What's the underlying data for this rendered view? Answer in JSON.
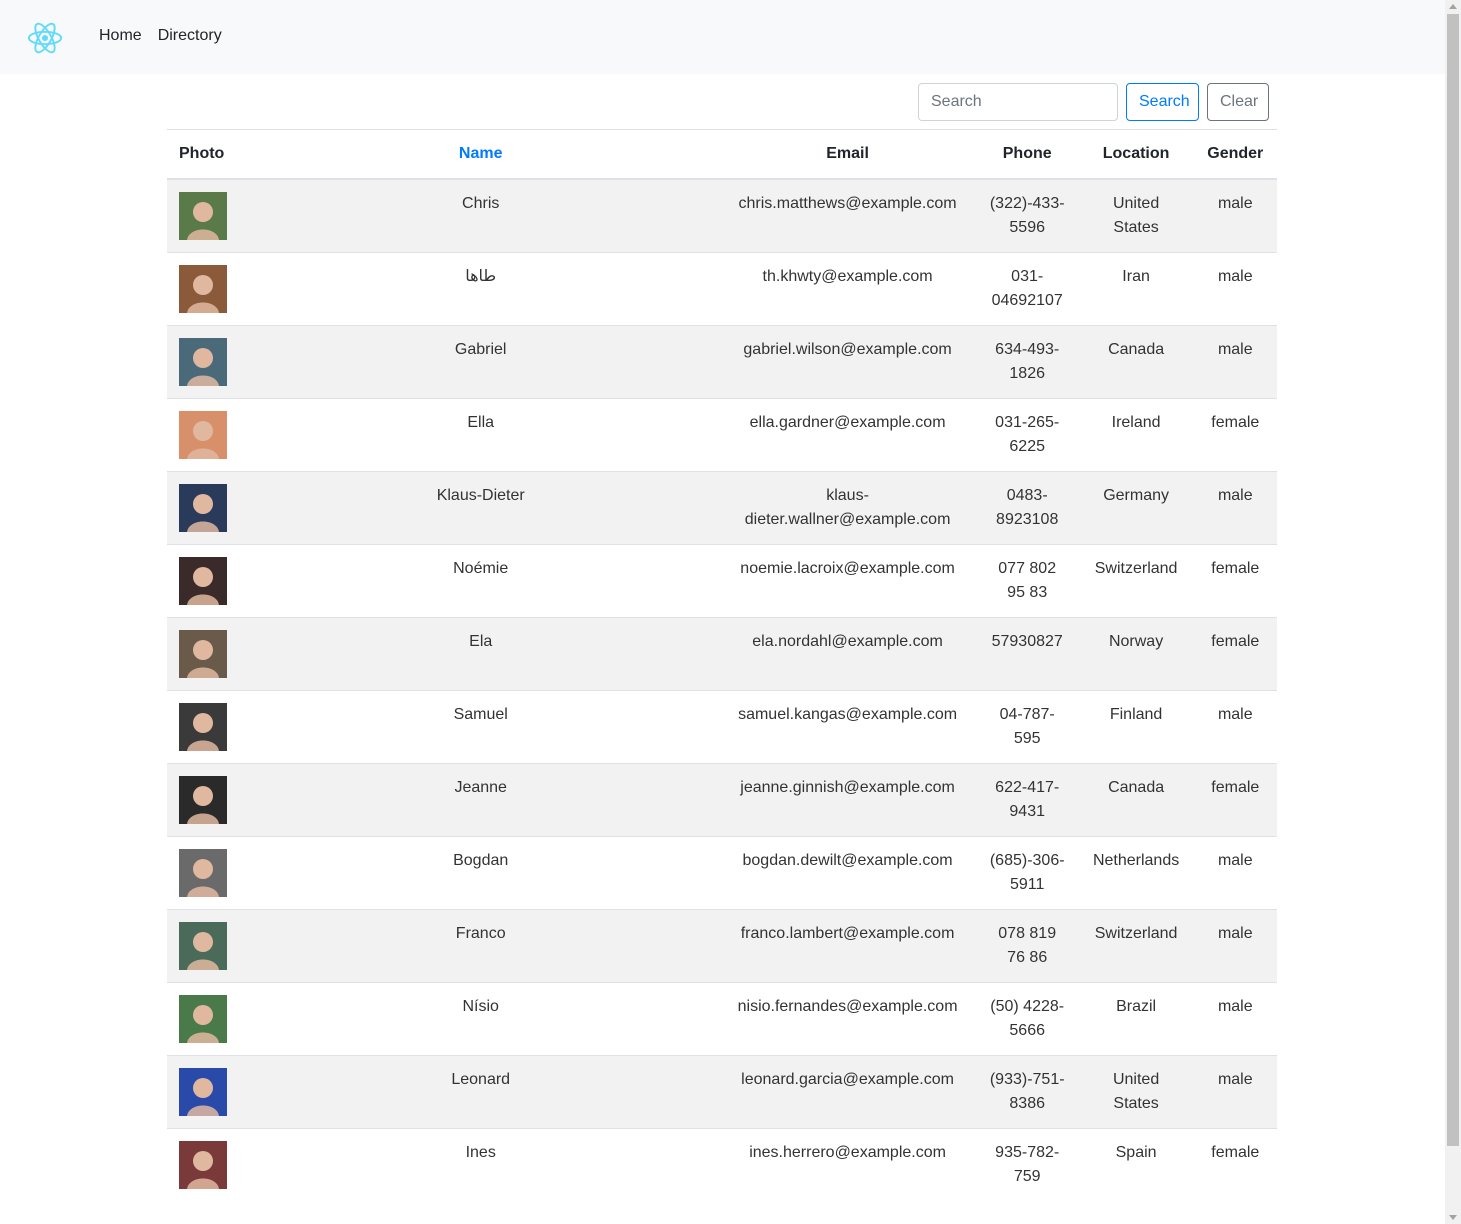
{
  "nav": {
    "home": "Home",
    "directory": "Directory",
    "brand_icon": "react-atom-icon",
    "brand_color": "#61dafb"
  },
  "search": {
    "placeholder": "Search",
    "button_label": "Search",
    "clear_label": "Clear"
  },
  "table": {
    "headers": {
      "photo": "Photo",
      "name": "Name",
      "email": "Email",
      "phone": "Phone",
      "location": "Location",
      "gender": "Gender"
    },
    "rows": [
      {
        "name": "Chris",
        "email": "chris.matthews@example.com",
        "phone": "(322)-433-5596",
        "location": "United States",
        "gender": "male",
        "avatar_color": "#5a7a4a"
      },
      {
        "name": "طاها",
        "email": "th.khwty@example.com",
        "phone": "031-04692107",
        "location": "Iran",
        "gender": "male",
        "avatar_color": "#8a5a3a"
      },
      {
        "name": "Gabriel",
        "email": "gabriel.wilson@example.com",
        "phone": "634-493-1826",
        "location": "Canada",
        "gender": "male",
        "avatar_color": "#4a6a7a"
      },
      {
        "name": "Ella",
        "email": "ella.gardner@example.com",
        "phone": "031-265-6225",
        "location": "Ireland",
        "gender": "female",
        "avatar_color": "#d8906a"
      },
      {
        "name": "Klaus-Dieter",
        "email": "klaus-dieter.wallner@example.com",
        "phone": "0483-8923108",
        "location": "Germany",
        "gender": "male",
        "avatar_color": "#2a3a5a"
      },
      {
        "name": "Noémie",
        "email": "noemie.lacroix@example.com",
        "phone": "077 802 95 83",
        "location": "Switzerland",
        "gender": "female",
        "avatar_color": "#3a2a2a"
      },
      {
        "name": "Ela",
        "email": "ela.nordahl@example.com",
        "phone": "57930827",
        "location": "Norway",
        "gender": "female",
        "avatar_color": "#6a5a4a"
      },
      {
        "name": "Samuel",
        "email": "samuel.kangas@example.com",
        "phone": "04-787-595",
        "location": "Finland",
        "gender": "male",
        "avatar_color": "#3a3a3a"
      },
      {
        "name": "Jeanne",
        "email": "jeanne.ginnish@example.com",
        "phone": "622-417-9431",
        "location": "Canada",
        "gender": "female",
        "avatar_color": "#2a2a2a"
      },
      {
        "name": "Bogdan",
        "email": "bogdan.dewilt@example.com",
        "phone": "(685)-306-5911",
        "location": "Netherlands",
        "gender": "male",
        "avatar_color": "#6a6a6a"
      },
      {
        "name": "Franco",
        "email": "franco.lambert@example.com",
        "phone": "078 819 76 86",
        "location": "Switzerland",
        "gender": "male",
        "avatar_color": "#4a6a5a"
      },
      {
        "name": "Nísio",
        "email": "nisio.fernandes@example.com",
        "phone": "(50) 4228-5666",
        "location": "Brazil",
        "gender": "male",
        "avatar_color": "#4a7a4a"
      },
      {
        "name": "Leonard",
        "email": "leonard.garcia@example.com",
        "phone": "(933)-751-8386",
        "location": "United States",
        "gender": "male",
        "avatar_color": "#2a4aaa"
      },
      {
        "name": "Ines",
        "email": "ines.herrero@example.com",
        "phone": "935-782-759",
        "location": "Spain",
        "gender": "female",
        "avatar_color": "#7a3a3a"
      }
    ]
  }
}
